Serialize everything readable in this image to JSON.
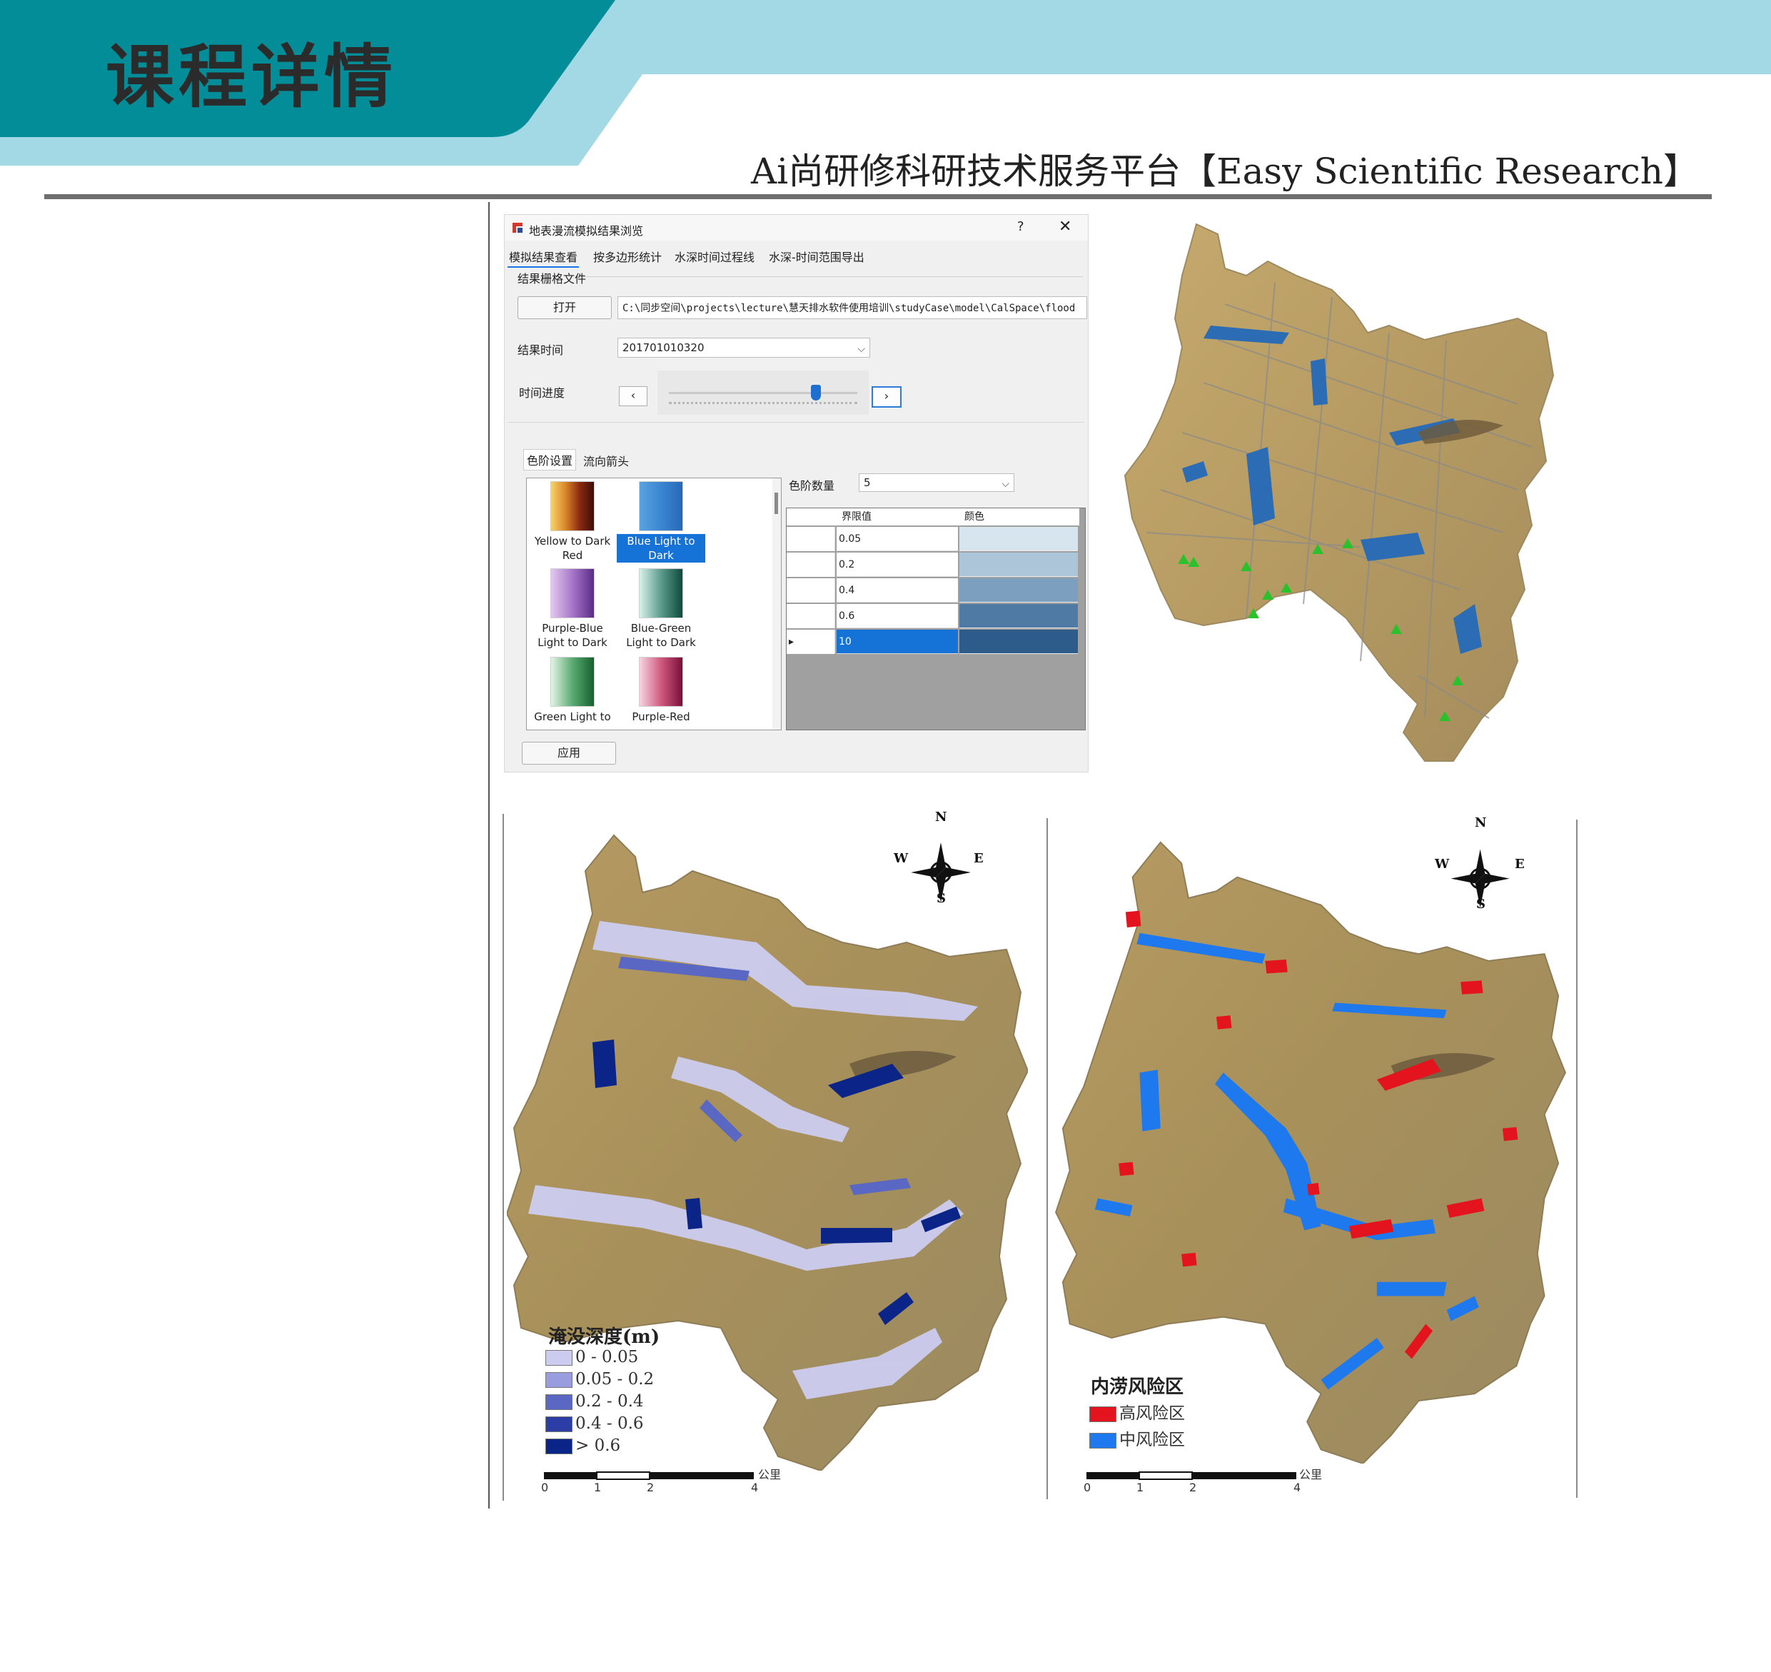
{
  "header": {
    "title": "课程详情",
    "subtitle": "Ai尚研修科研技术服务平台【Easy Scientific Research】",
    "colors": {
      "banner_dark": "#028d98",
      "banner_light": "#a3d8e5"
    }
  },
  "dialog": {
    "window_title": "地表漫流模拟结果浏览",
    "help": "?",
    "close": "✕",
    "tabs": [
      "模拟结果查看",
      "按多边形统计",
      "水深时间过程线",
      "水深-时间范围导出"
    ],
    "group_label": "结果栅格文件",
    "open_button": "打开",
    "file_path": "C:\\同步空间\\projects\\lecture\\慧天排水软件使用培训\\studyCase\\model\\CalSpace\\flood",
    "result_time_label": "结果时间",
    "result_time_value": "201701010320",
    "time_progress_label": "时间进度",
    "slider_value": 0.78,
    "prev_button": "‹",
    "next_button": "›",
    "sub_tabs": [
      "色阶设置",
      "流向箭头"
    ],
    "color_ramps": [
      {
        "line1": "Yellow to Dark",
        "line2": "Red",
        "selected": false
      },
      {
        "line1": "Blue Light to",
        "line2": "Dark",
        "selected": true
      },
      {
        "line1": "Purple-Blue",
        "line2": "Light to Dark",
        "selected": false
      },
      {
        "line1": "Blue-Green",
        "line2": "Light to Dark",
        "selected": false
      },
      {
        "line1": "Green Light to",
        "line2": "",
        "selected": false
      },
      {
        "line1": "Purple-Red",
        "line2": "",
        "selected": false
      }
    ],
    "class_count_label": "色阶数量",
    "class_count_value": "5",
    "table": {
      "headers": [
        "界限值",
        "颜色"
      ],
      "rows": [
        {
          "value": "0.05",
          "color": "#d6e5ee"
        },
        {
          "value": "0.2",
          "color": "#adc5d8"
        },
        {
          "value": "0.4",
          "color": "#7d9fbf"
        },
        {
          "value": "0.6",
          "color": "#4f7aa3"
        },
        {
          "value": "10",
          "color": "#2e5c8a"
        }
      ]
    },
    "apply_button": "应用"
  },
  "map_left": {
    "legend_title": "淹没深度(m)",
    "legend": [
      {
        "label": "0 - 0.05",
        "color": "#ccccf0"
      },
      {
        "label": "0.05 - 0.2",
        "color": "#9a9ce0"
      },
      {
        "label": "0.2 - 0.4",
        "color": "#5a68c4"
      },
      {
        "label": "0.4 - 0.6",
        "color": "#2c3da6"
      },
      {
        "label": "> 0.6",
        "color": "#0a2488"
      }
    ],
    "scale_ticks": [
      "0",
      "1",
      "2",
      "4"
    ],
    "scale_unit": "公里",
    "compass": {
      "n": "N",
      "s": "S",
      "e": "E",
      "w": "W"
    }
  },
  "map_right": {
    "legend_title": "内涝风险区",
    "legend": [
      {
        "label": "高风险区",
        "color": "#e4141e"
      },
      {
        "label": "中风险区",
        "color": "#1e78ee"
      }
    ],
    "scale_ticks": [
      "0",
      "1",
      "2",
      "4"
    ],
    "scale_unit": "公里",
    "compass": {
      "n": "N",
      "s": "S",
      "e": "E",
      "w": "W"
    }
  }
}
